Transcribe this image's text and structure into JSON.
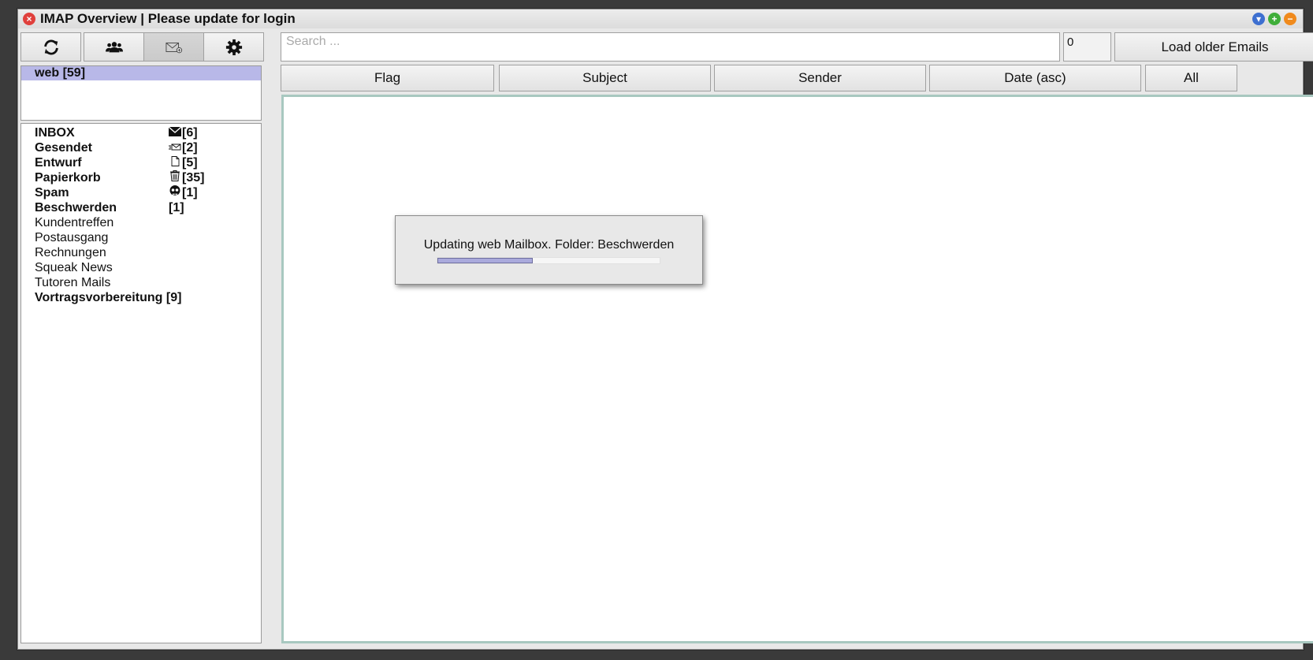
{
  "window": {
    "title": "IMAP Overview | Please update for login",
    "controls": {
      "close_glyph": "×",
      "menu_glyph": "▾",
      "expand_glyph": "+",
      "collapse_glyph": "−"
    }
  },
  "toolbar": {
    "buttons": [
      {
        "name": "refresh-icon",
        "pressed": false
      },
      {
        "name": "users-icon",
        "pressed": false
      },
      {
        "name": "new-mail-icon",
        "pressed": true
      },
      {
        "name": "gear-icon",
        "pressed": false
      }
    ]
  },
  "search": {
    "placeholder": "Search ...",
    "value": ""
  },
  "email_count": "0",
  "load_older_label": "Load older Emails",
  "accounts": [
    {
      "label": "web [59]",
      "selected": true
    }
  ],
  "folders": [
    {
      "name": "INBOX",
      "bold": true,
      "icon": "envelope-icon",
      "count": "[6]"
    },
    {
      "name": "Gesendet",
      "bold": true,
      "icon": "sent-icon",
      "count": "[2]"
    },
    {
      "name": "Entwurf",
      "bold": true,
      "icon": "draft-icon",
      "count": "[5]"
    },
    {
      "name": "Papierkorb",
      "bold": true,
      "icon": "trash-icon",
      "count": "[35]"
    },
    {
      "name": "Spam",
      "bold": true,
      "icon": "skull-icon",
      "count": "[1]"
    },
    {
      "name": "Beschwerden",
      "bold": true,
      "icon": "",
      "count": "[1]"
    },
    {
      "name": "Kundentreffen",
      "bold": false,
      "icon": "",
      "count": ""
    },
    {
      "name": "Postausgang",
      "bold": false,
      "icon": "",
      "count": ""
    },
    {
      "name": "Rechnungen",
      "bold": false,
      "icon": "",
      "count": ""
    },
    {
      "name": "Squeak News",
      "bold": false,
      "icon": "",
      "count": ""
    },
    {
      "name": "Tutoren Mails",
      "bold": false,
      "icon": "",
      "count": ""
    },
    {
      "name": "Vortragsvorbereitung",
      "bold": true,
      "icon": "",
      "count": "[9]",
      "inline": true
    }
  ],
  "columns": {
    "flag": "Flag",
    "subject": "Subject",
    "sender": "Sender",
    "date": "Date (asc)",
    "all": "All"
  },
  "progress": {
    "message": "Updating web Mailbox. Folder: Beschwerden",
    "fraction": 0.43
  },
  "colors": {
    "selection": "#b8b8e8",
    "progress_fill": "#aaaadc",
    "list_border": "#a8c8c0"
  }
}
